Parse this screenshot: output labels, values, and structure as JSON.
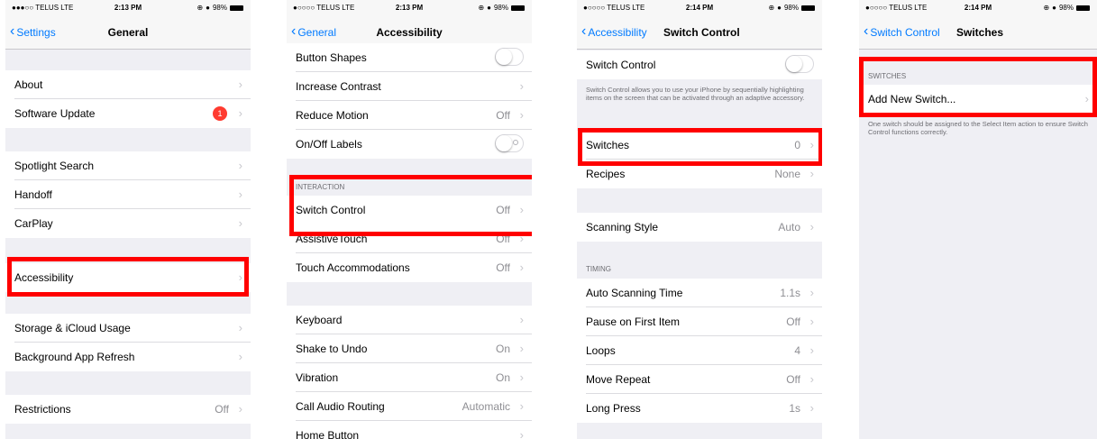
{
  "screens": [
    {
      "status": {
        "carrier": "●●●○○ TELUS  LTE",
        "time": "2:13 PM",
        "battery": "98%"
      },
      "nav": {
        "back": "Settings",
        "title": "General"
      },
      "rows": [
        {
          "label": "About"
        },
        {
          "label": "Software Update",
          "badge": "1"
        },
        {
          "label": "Spotlight Search"
        },
        {
          "label": "Handoff"
        },
        {
          "label": "CarPlay"
        },
        {
          "label": "Accessibility"
        },
        {
          "label": "Storage & iCloud Usage"
        },
        {
          "label": "Background App Refresh"
        },
        {
          "label": "Restrictions",
          "value": "Off"
        }
      ]
    },
    {
      "status": {
        "carrier": "●○○○○ TELUS  LTE",
        "time": "2:13 PM",
        "battery": "98%"
      },
      "nav": {
        "back": "General",
        "title": "Accessibility"
      },
      "rows": [
        {
          "label": "Button Shapes"
        },
        {
          "label": "Increase Contrast"
        },
        {
          "label": "Reduce Motion",
          "value": "Off"
        },
        {
          "label": "On/Off Labels"
        },
        {
          "label": "Switch Control",
          "value": "Off"
        },
        {
          "label": "AssistiveTouch",
          "value": "Off"
        },
        {
          "label": "Touch Accommodations",
          "value": "Off"
        },
        {
          "label": "Keyboard"
        },
        {
          "label": "Shake to Undo",
          "value": "On"
        },
        {
          "label": "Vibration",
          "value": "On"
        },
        {
          "label": "Call Audio Routing",
          "value": "Automatic"
        },
        {
          "label": "Home Button"
        }
      ],
      "section_header": "INTERACTION"
    },
    {
      "status": {
        "carrier": "●○○○○ TELUS  LTE",
        "time": "2:14 PM",
        "battery": "98%"
      },
      "nav": {
        "back": "Accessibility",
        "title": "Switch Control"
      },
      "rows": [
        {
          "label": "Switch Control"
        },
        {
          "label": "Switches",
          "value": "0"
        },
        {
          "label": "Recipes",
          "value": "None"
        },
        {
          "label": "Scanning Style",
          "value": "Auto"
        },
        {
          "label": "Auto Scanning Time",
          "value": "1.1s"
        },
        {
          "label": "Pause on First Item",
          "value": "Off"
        },
        {
          "label": "Loops",
          "value": "4"
        },
        {
          "label": "Move Repeat",
          "value": "Off"
        },
        {
          "label": "Long Press",
          "value": "1s"
        }
      ],
      "description": "Switch Control allows you to use your iPhone by sequentially highlighting items on the screen that can be activated through an adaptive accessory.",
      "section_header": "TIMING"
    },
    {
      "status": {
        "carrier": "●○○○○ TELUS  LTE",
        "time": "2:14 PM",
        "battery": "98%"
      },
      "nav": {
        "back": "Switch Control",
        "title": "Switches"
      },
      "rows": [
        {
          "label": "Add New Switch..."
        }
      ],
      "section_header": "SWITCHES",
      "footer": "One switch should be assigned to the Select Item action to ensure Switch Control functions correctly."
    }
  ],
  "colors": {
    "accent": "#007aff",
    "highlight": "#ff0000",
    "badge": "#ff3b30"
  }
}
